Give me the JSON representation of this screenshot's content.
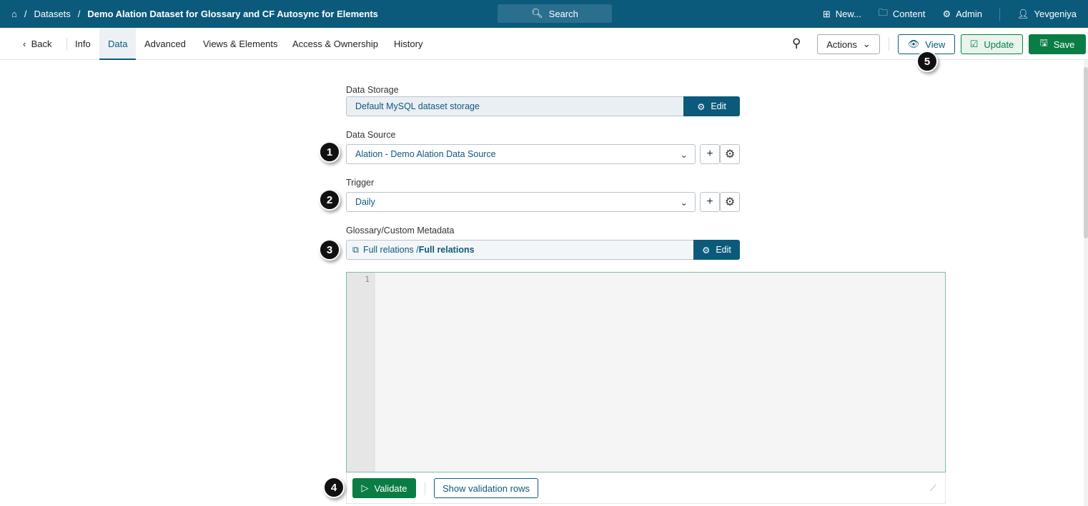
{
  "topbar": {
    "crumbs": [
      "Datasets",
      "Demo Alation Dataset for Glossary and CF Autosync for Elements"
    ],
    "search": "Search",
    "new": "New...",
    "content": "Content",
    "admin": "Admin",
    "user": "Yevgeniya"
  },
  "tabs": {
    "back": "Back",
    "items": [
      "Info",
      "Data",
      "Advanced",
      "Views & Elements",
      "Access & Ownership",
      "History"
    ]
  },
  "toolbar": {
    "actions": "Actions",
    "view": "View",
    "update": "Update",
    "save": "Save"
  },
  "form": {
    "storage_label": "Data Storage",
    "storage_value": "Default MySQL dataset storage",
    "edit": "Edit",
    "source_label": "Data Source",
    "source_value": "Alation - Demo Alation Data Source",
    "trigger_label": "Trigger",
    "trigger_value": "Daily",
    "glossary_label": "Glossary/Custom Metadata",
    "glossary_prefix": "Full relations / ",
    "glossary_value": "Full relations"
  },
  "editor": {
    "line": "1",
    "validate": "Validate",
    "show_rows": "Show validation rows"
  },
  "badges": [
    "1",
    "2",
    "3",
    "4",
    "5"
  ],
  "colors": {
    "brand": "#0b5a7c",
    "green": "#0a7d45"
  }
}
